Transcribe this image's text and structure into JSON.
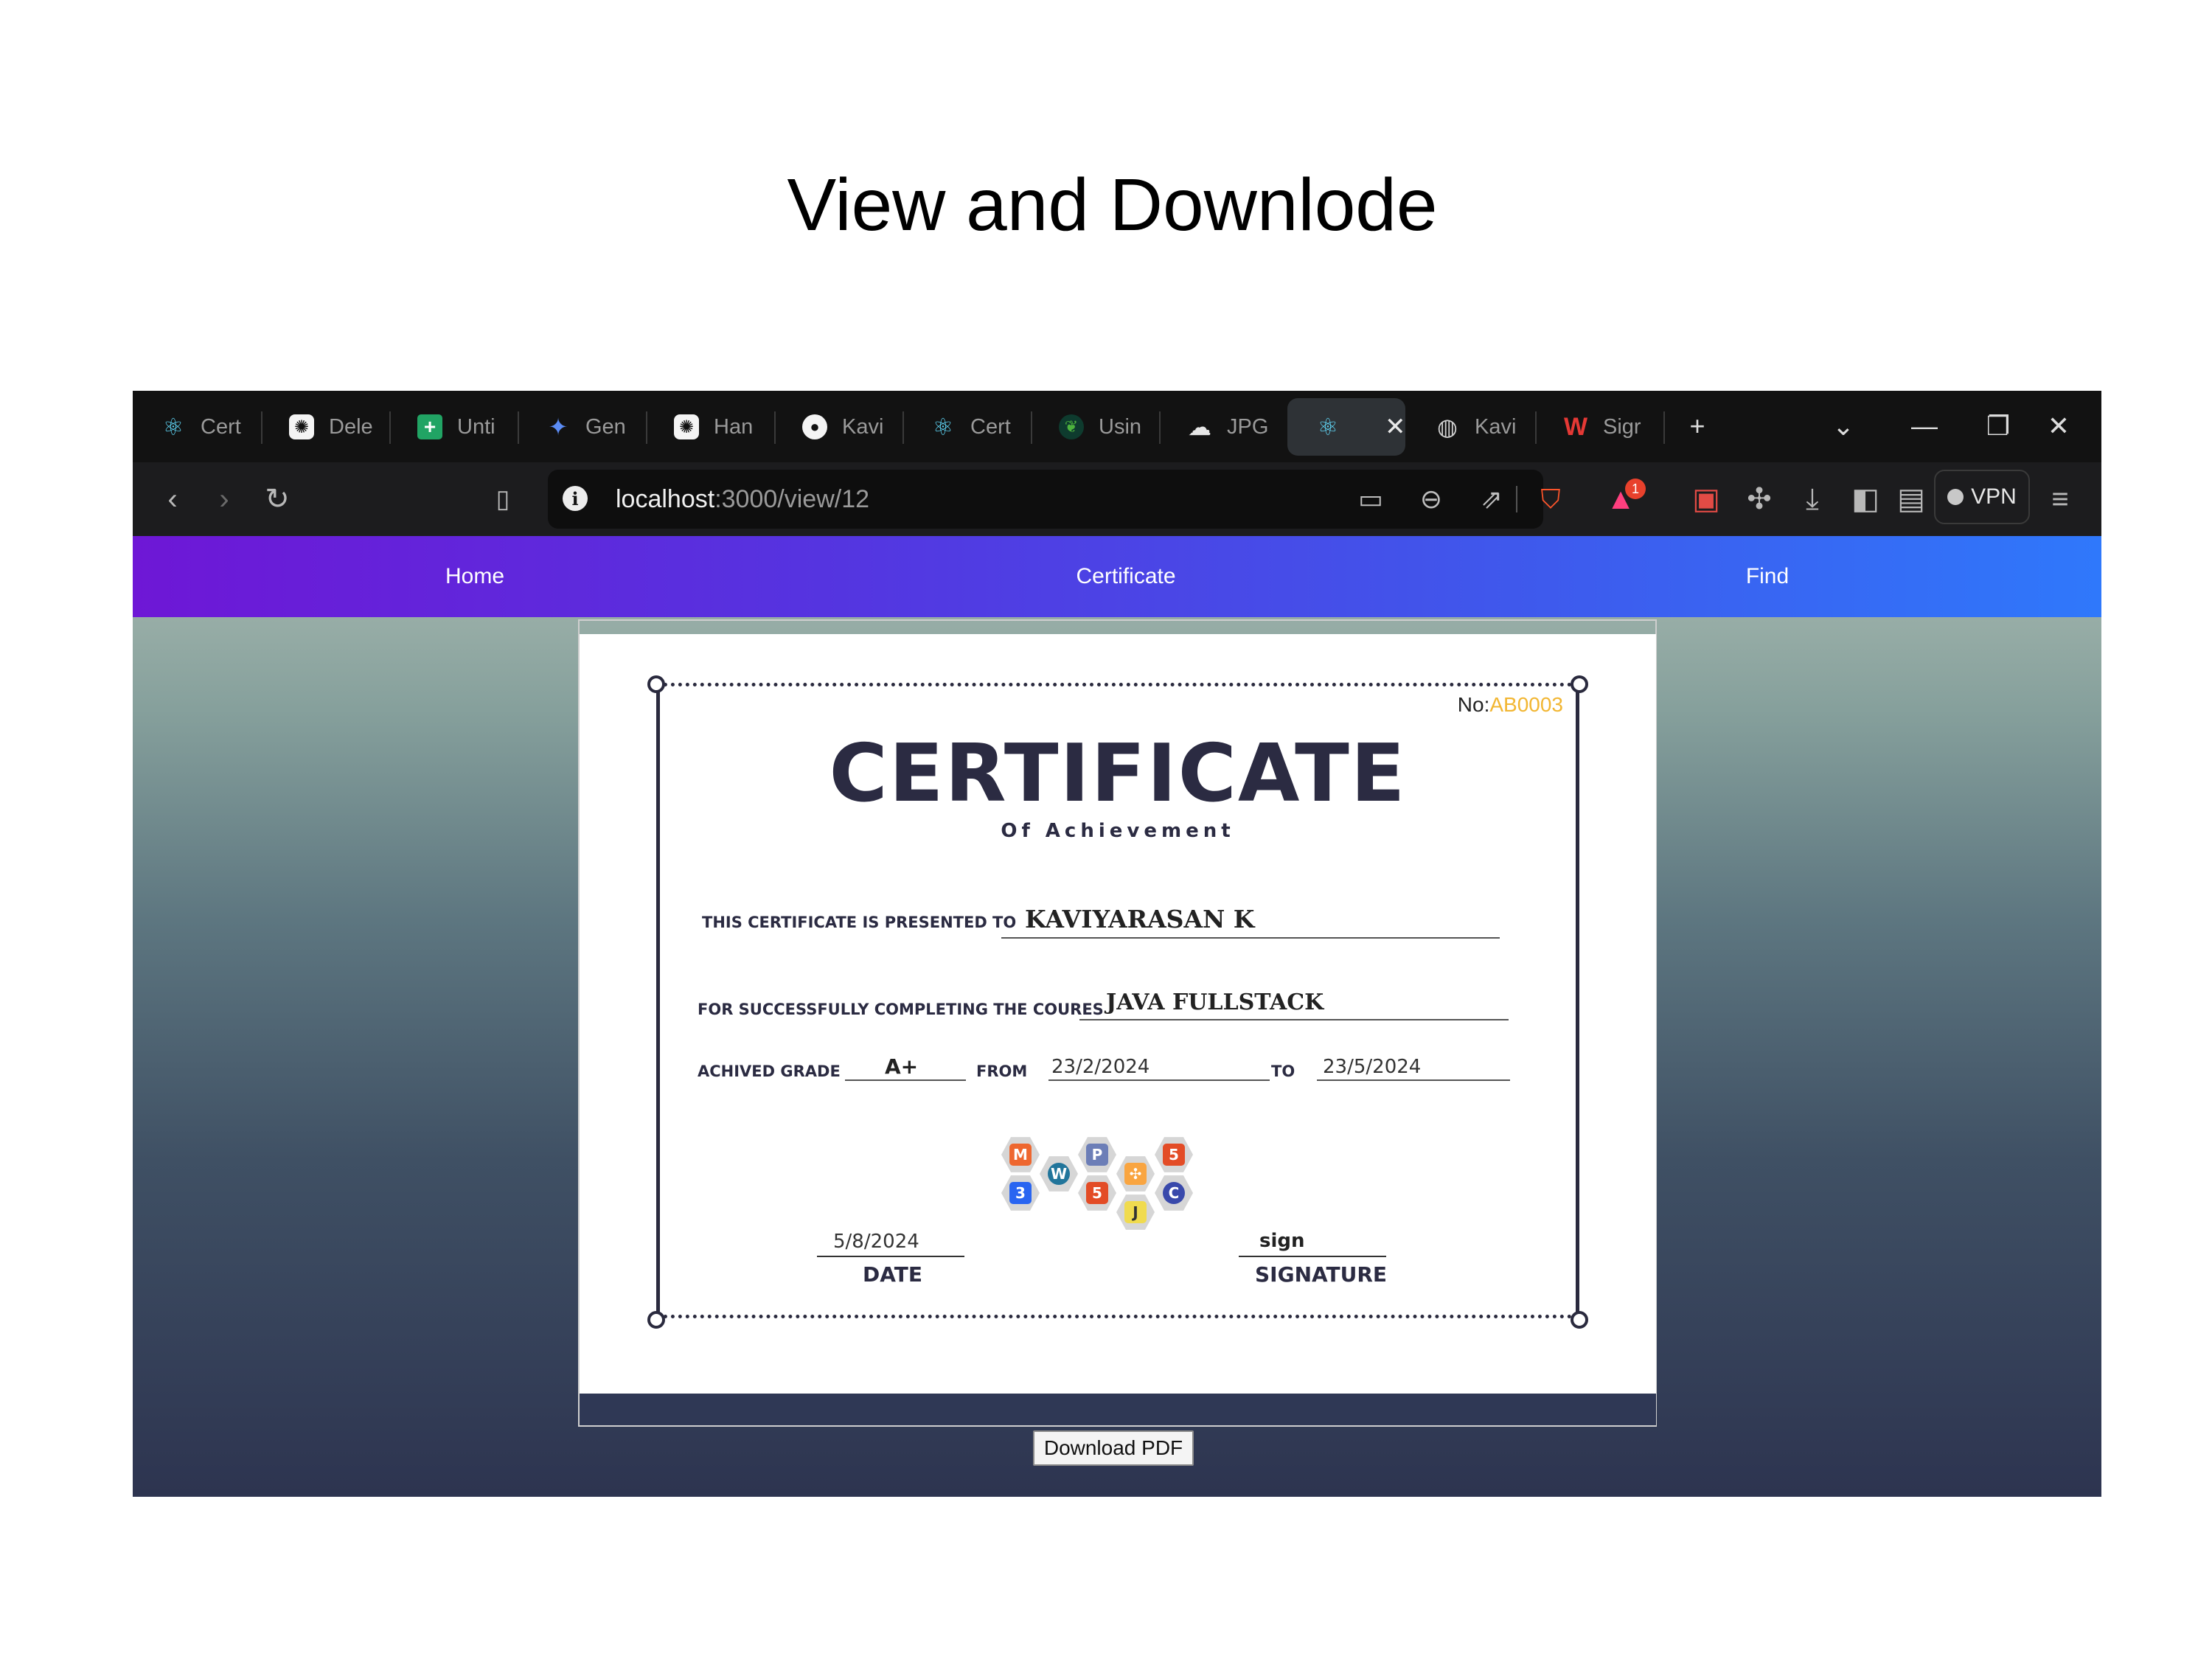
{
  "slide": {
    "title": "View and Downlode"
  },
  "tabs": [
    {
      "label": "Cert",
      "icon": "react-icon"
    },
    {
      "label": "Dele",
      "icon": "chatgpt-icon"
    },
    {
      "label": "Unti",
      "icon": "sheets-icon"
    },
    {
      "label": "Gen",
      "icon": "gemini-icon"
    },
    {
      "label": "Han",
      "icon": "chatgpt-icon"
    },
    {
      "label": "Kavi",
      "icon": "github-icon"
    },
    {
      "label": "Cert",
      "icon": "react-icon"
    },
    {
      "label": "Usin",
      "icon": "mongodb-icon"
    },
    {
      "label": "JPG",
      "icon": "cloud-icon"
    },
    {
      "label": "",
      "icon": "react-icon",
      "active": true
    },
    {
      "label": "Kavi",
      "icon": "globe-icon"
    },
    {
      "label": "Sigr",
      "icon": "wps-icon"
    }
  ],
  "browser": {
    "url_host": "localhost",
    "url_path": ":3000/view/12",
    "vpn_label": "VPN",
    "notification_count": "1"
  },
  "nav": {
    "home": "Home",
    "certificate": "Certificate",
    "find": "Find"
  },
  "certificate": {
    "number_label": "No:",
    "number_value": "AB0003",
    "title": "CERTIFICATE",
    "subtitle": "Of Achievement",
    "presented_label": "THIS CERTIFICATE IS PRESENTED TO",
    "recipient": "KAVIYARASAN K",
    "course_label": "FOR SUCCESSFULLY COMPLETING THE COURES",
    "course": "JAVA FULLSTACK",
    "grade_label": "ACHIVED GRADE",
    "grade": "A+",
    "from_label": "FROM",
    "from_date": "23/2/2024",
    "to_label": "TO",
    "to_date": "23/5/2024",
    "issue_date": "5/8/2024",
    "date_label": "DATE",
    "sign_value": "sign",
    "signature_label": "SIGNATURE",
    "logos": [
      "magento",
      "wordpress",
      "php",
      "joomla",
      "html5",
      "css3",
      "html5",
      "javascript",
      "c"
    ]
  },
  "download": {
    "label": "Download PDF"
  },
  "colors": {
    "nav_start": "#6e17d6",
    "nav_end": "#2f78fb",
    "cert_number": "#f2b632",
    "cert_text": "#2b2b42"
  }
}
